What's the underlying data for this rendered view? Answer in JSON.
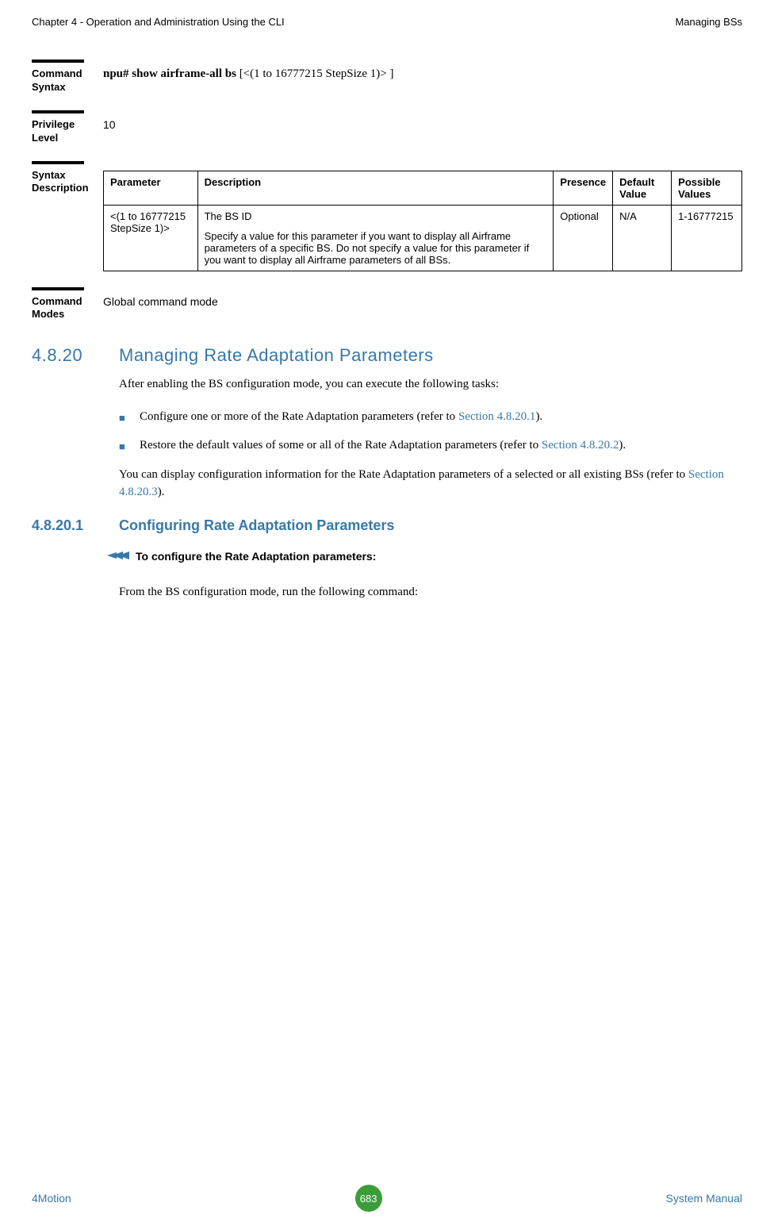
{
  "header": {
    "left": "Chapter 4 - Operation and Administration Using the CLI",
    "right": "Managing BSs"
  },
  "blocks": {
    "command_syntax_label": "Command Syntax",
    "command_syntax_bold": "npu# show airframe-all bs",
    "command_syntax_rest": " [<(1 to 16777215 StepSize 1)> ]",
    "privilege_label": "Privilege Level",
    "privilege_value": "10",
    "syntax_desc_label": "Syntax Description",
    "command_modes_label": "Command Modes",
    "command_modes_value": "Global command mode"
  },
  "table": {
    "headers": {
      "parameter": "Parameter",
      "description": "Description",
      "presence": "Presence",
      "default": "Default Value",
      "possible": "Possible Values"
    },
    "row": {
      "parameter": "<(1 to 16777215 StepSize 1)>",
      "desc_p1": "The BS ID",
      "desc_p2": "Specify a value for this parameter if you want to display all Airframe parameters of a specific BS. Do not specify a value for this parameter if you want to display all Airframe parameters of all BSs.",
      "presence": "Optional",
      "default": "N/A",
      "possible": "1-16777215"
    }
  },
  "section": {
    "num": "4.8.20",
    "title": "Managing Rate Adaptation Parameters",
    "intro": "After enabling the BS configuration mode, you can execute the following tasks:",
    "bullet1_pre": "Configure one or more of the Rate Adaptation parameters (refer to ",
    "bullet1_link": "Section 4.8.20.1",
    "bullet1_post": ").",
    "bullet2_pre": "Restore the default values of some or all of the Rate Adaptation parameters (refer to ",
    "bullet2_link": "Section 4.8.20.2",
    "bullet2_post": ").",
    "para2_pre": "You can display configuration information for the Rate Adaptation parameters of a selected or all existing BSs (refer to ",
    "para2_link": "Section 4.8.20.3",
    "para2_post": ")."
  },
  "subsection": {
    "num": "4.8.20.1",
    "title": "Configuring Rate Adaptation Parameters",
    "arrow_label": "To configure the Rate Adaptation parameters:",
    "run_cmd": "From the BS configuration mode, run the following command:"
  },
  "footer": {
    "left": "4Motion",
    "page": "683",
    "right": "System Manual"
  }
}
